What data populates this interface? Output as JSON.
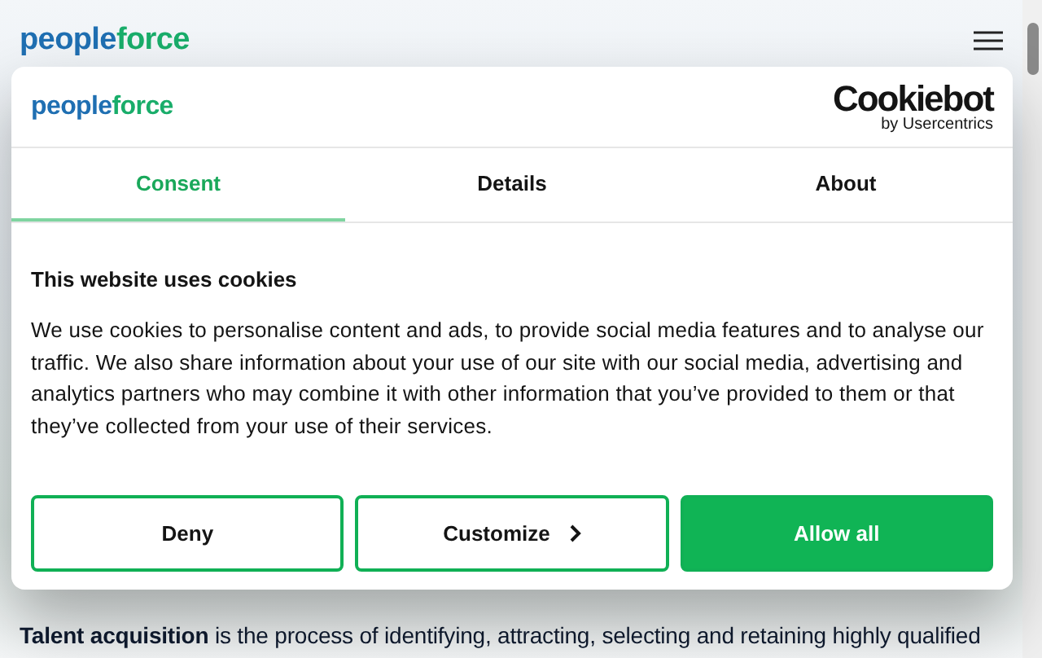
{
  "header": {
    "logo": [
      "people",
      "force"
    ]
  },
  "dialog": {
    "logo": [
      "people",
      "force"
    ],
    "cookiebot": {
      "name": "Cookiebot",
      "by": "by Usercentrics"
    },
    "tabs": [
      {
        "label": "Consent",
        "selected": true
      },
      {
        "label": "Details",
        "selected": false
      },
      {
        "label": "About",
        "selected": false
      }
    ],
    "title": "This website uses cookies",
    "body": "We use cookies to personalise content and ads, to provide social media features and to analyse our traffic. We also share information about your use of our site with our social media, advertising and analytics partners who may combine it with other information that you’ve provided to them or that they’ve collected from your use of their services.",
    "buttons": [
      {
        "label": "Deny",
        "kind": "outline"
      },
      {
        "label": "Customize",
        "kind": "more"
      },
      {
        "label": "Allow all",
        "kind": "primary"
      }
    ]
  },
  "article": {
    "paragraph": "**Talent acquisition** is the process of identifying, attracting, selecting and retaining highly qualified"
  }
}
